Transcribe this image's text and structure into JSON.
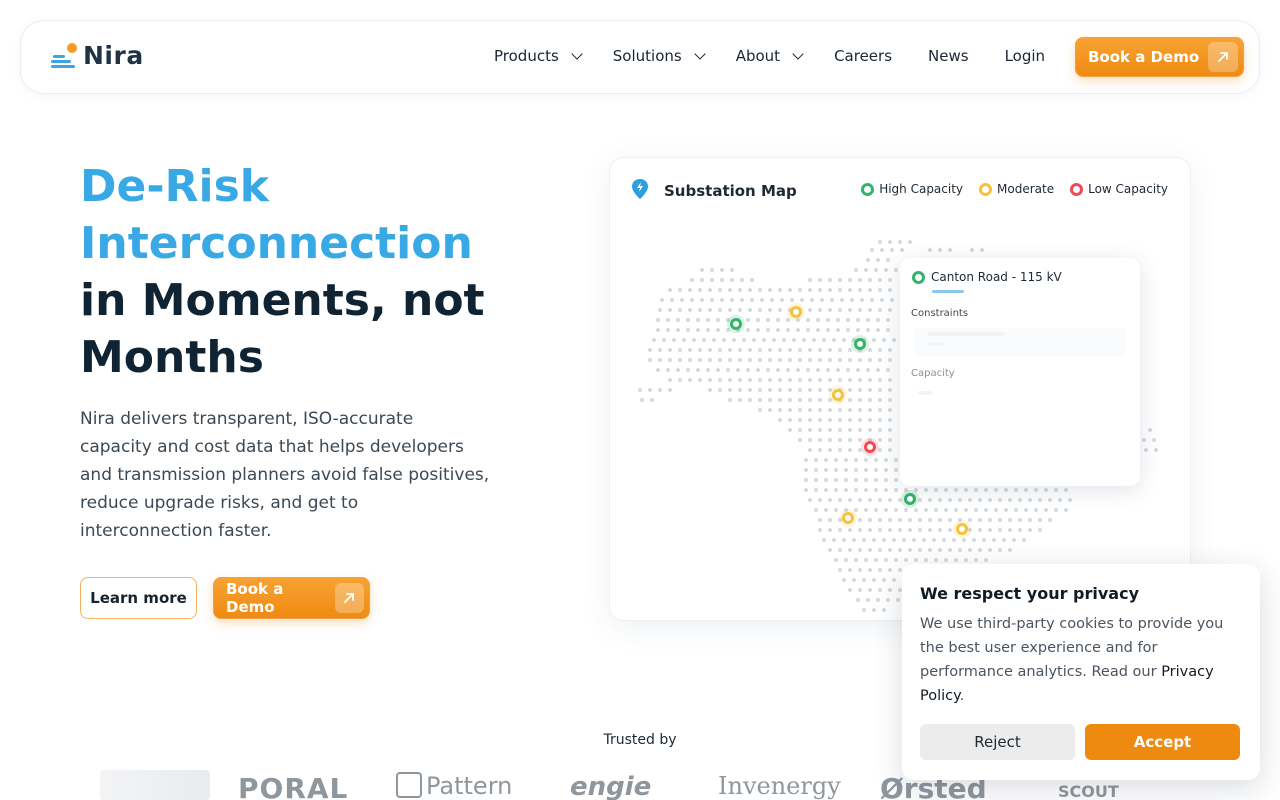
{
  "brand": {
    "name": "Nira"
  },
  "nav": {
    "items": [
      {
        "label": "Products",
        "dropdown": true
      },
      {
        "label": "Solutions",
        "dropdown": true
      },
      {
        "label": "About",
        "dropdown": true
      },
      {
        "label": "Careers",
        "dropdown": false
      },
      {
        "label": "News",
        "dropdown": false
      },
      {
        "label": "Login",
        "dropdown": false
      }
    ],
    "cta_label": "Book a Demo"
  },
  "hero": {
    "title_line1": "De-Risk",
    "title_line2": "Interconnection",
    "title_line3": "in Moments, not",
    "title_line4": "Months",
    "description": "Nira delivers transparent, ISO-accurate capacity and cost data that helps developers and transmission planners avoid false positives, reduce upgrade risks, and get to interconnection faster.",
    "learn_more_label": "Learn more",
    "book_demo_label": "Book a Demo"
  },
  "map_card": {
    "title": "Substation Map",
    "legend": [
      {
        "label": "High Capacity",
        "color": "#34b36b"
      },
      {
        "label": "Moderate",
        "color": "#f5c33b"
      },
      {
        "label": "Low Capacity",
        "color": "#ee4b57"
      }
    ],
    "detail": {
      "substation": "Canton Road - 115 kV",
      "constraints_label": "Constraints",
      "capacity_label": "Capacity"
    }
  },
  "trusted": {
    "label": "Trusted by",
    "logos": [
      "PORAL",
      "Pattern",
      "engie",
      "Invenergy",
      "Ørsted",
      "SCOUT"
    ]
  },
  "cookie": {
    "title": "We respect your privacy",
    "text": "We use third-party cookies to provide you the best user experience and for performance analytics. Read our ",
    "link_label": "Privacy Policy",
    "text_end": ".",
    "reject_label": "Reject",
    "accept_label": "Accept"
  },
  "colors": {
    "accent_blue": "#38a9e5",
    "accent_orange": "#ef8a11",
    "dark_text": "#0f2333"
  }
}
